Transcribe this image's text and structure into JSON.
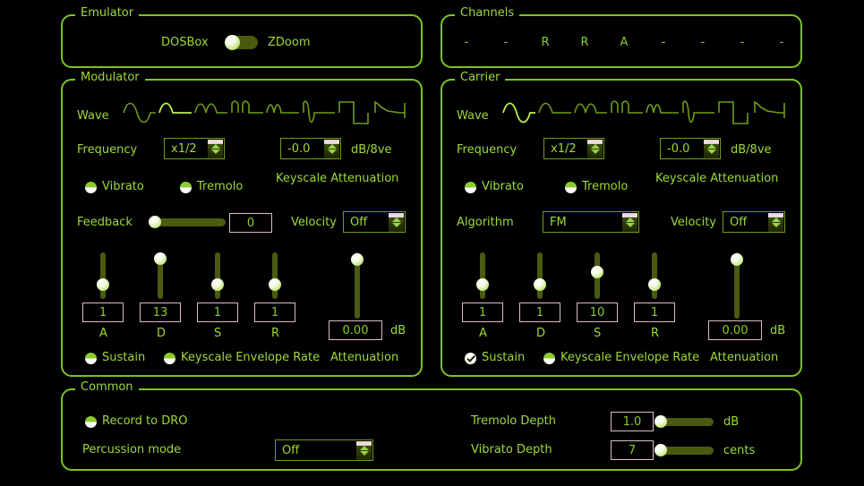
{
  "emulator": {
    "legend": "Emulator",
    "left_label": "DOSBox",
    "right_label": "ZDoom",
    "selected": "DOSBox"
  },
  "channels": {
    "legend": "Channels",
    "values": [
      "-",
      "-",
      "R",
      "R",
      "A",
      "-",
      "-",
      "-",
      "-"
    ]
  },
  "modulator": {
    "legend": "Modulator",
    "wave_label": "Wave",
    "wave_icons": [
      "sine-wave-icon",
      "half-sine-wave-icon",
      "abs-sine-wave-icon",
      "pulse-sine-wave-icon",
      "even-sine-wave-icon",
      "even-abs-sine-wave-icon",
      "square-wave-icon",
      "log-saw-wave-icon"
    ],
    "wave_selected_index": 1,
    "frequency_label": "Frequency",
    "frequency_value": "x1/2",
    "keyscale_value": "-0.0",
    "db_per_octave_label": "dB/8ve",
    "keyscale_label": "Keyscale Attenuation",
    "vibrato_label": "Vibrato",
    "vibrato_checked": false,
    "tremolo_label": "Tremolo",
    "tremolo_checked": false,
    "feedback_label": "Feedback",
    "feedback_value": "0",
    "feedback_slider_pct": 0,
    "velocity_label": "Velocity",
    "velocity_value": "Off",
    "envelope": [
      {
        "name": "A",
        "value": "1",
        "slider_pct": 76
      },
      {
        "name": "D",
        "value": "13",
        "slider_pct": 18
      },
      {
        "name": "S",
        "value": "1",
        "slider_pct": 76
      },
      {
        "name": "R",
        "value": "1",
        "slider_pct": 76
      }
    ],
    "attenuation_value": "0.00",
    "attenuation_unit": "dB",
    "attenuation_slider_pct": 3,
    "sustain_label": "Sustain",
    "sustain_checked": false,
    "keyscale_env_label": "Keyscale Envelope Rate",
    "keyscale_env_checked": false,
    "attenuation_label": "Attenuation"
  },
  "carrier": {
    "legend": "Carrier",
    "wave_label": "Wave",
    "wave_icons": [
      "sine-wave-icon",
      "half-sine-wave-icon",
      "abs-sine-wave-icon",
      "pulse-sine-wave-icon",
      "even-sine-wave-icon",
      "even-abs-sine-wave-icon",
      "square-wave-icon",
      "log-saw-wave-icon"
    ],
    "wave_selected_index": 0,
    "frequency_label": "Frequency",
    "frequency_value": "x1/2",
    "keyscale_value": "-0.0",
    "db_per_octave_label": "dB/8ve",
    "keyscale_label": "Keyscale Attenuation",
    "vibrato_label": "Vibrato",
    "vibrato_checked": false,
    "tremolo_label": "Tremolo",
    "tremolo_checked": false,
    "algorithm_label": "Algorithm",
    "algorithm_value": "FM",
    "velocity_label": "Velocity",
    "velocity_value": "Off",
    "envelope": [
      {
        "name": "A",
        "value": "1",
        "slider_pct": 76
      },
      {
        "name": "D",
        "value": "1",
        "slider_pct": 76
      },
      {
        "name": "S",
        "value": "10",
        "slider_pct": 42
      },
      {
        "name": "R",
        "value": "1",
        "slider_pct": 76
      }
    ],
    "attenuation_value": "0.00",
    "attenuation_unit": "dB",
    "attenuation_slider_pct": 3,
    "sustain_label": "Sustain",
    "sustain_checked": true,
    "keyscale_env_label": "Keyscale Envelope Rate",
    "keyscale_env_checked": false,
    "attenuation_label": "Attenuation"
  },
  "common": {
    "legend": "Common",
    "record_label": "Record to DRO",
    "record_checked": false,
    "percussion_label": "Percussion mode",
    "percussion_value": "Off",
    "tremolo_depth_label": "Tremolo Depth",
    "tremolo_depth_value": "1.0",
    "tremolo_depth_unit": "dB",
    "tremolo_depth_pct": 0,
    "vibrato_depth_label": "Vibrato Depth",
    "vibrato_depth_value": "7",
    "vibrato_depth_unit": "cents",
    "vibrato_depth_pct": 0
  },
  "colors": {
    "background": "#000000",
    "accent_green": "#8ccc2a",
    "border_green": "#7cc41f",
    "dim_green": "#4a5a10",
    "value_border": "#d8bccb",
    "highlight": "#b9f24a"
  }
}
